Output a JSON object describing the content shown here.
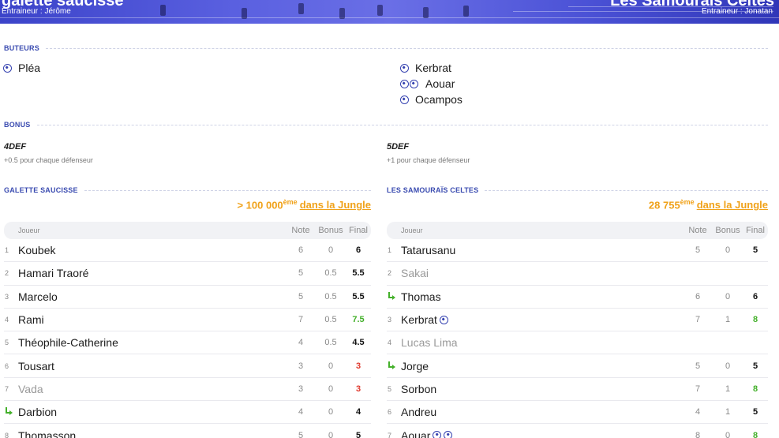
{
  "banner": {
    "left_team": "galette saucisse",
    "left_coach": "Entraineur : Jérôme",
    "right_team": "Les Samouraïs Celtes",
    "right_coach": "Entraineur : Jonatan"
  },
  "sections": {
    "scorers": "BUTEURS",
    "bonus": "BONUS",
    "left_team_header": "GALETTE SAUCISSE",
    "right_team_header": "LES SAMOURAÏS CELTES"
  },
  "scorers": {
    "left": [
      {
        "name": "Pléa",
        "goals": 1
      }
    ],
    "right": [
      {
        "name": "Kerbrat",
        "goals": 1
      },
      {
        "name": "Aouar",
        "goals": 2
      },
      {
        "name": "Ocampos",
        "goals": 1
      }
    ]
  },
  "bonus": {
    "left": {
      "name": "4DEF",
      "desc": "+0.5 pour chaque défenseur"
    },
    "right": {
      "name": "5DEF",
      "desc": "+1 pour chaque défenseur"
    }
  },
  "ranking": {
    "left": {
      "value": "> 100 000",
      "sup": "ème",
      "link": "dans la Jungle"
    },
    "right": {
      "value": "28 755",
      "sup": "ème",
      "link": "dans la Jungle"
    }
  },
  "table_headers": {
    "player": "Joueur",
    "note": "Note",
    "bonus": "Bonus",
    "final": "Final"
  },
  "left_players": [
    {
      "num": "1",
      "name": "Koubek",
      "note": "6",
      "bonus": "0",
      "final": "6",
      "status": "black"
    },
    {
      "num": "2",
      "name": "Hamari Traoré",
      "note": "5",
      "bonus": "0.5",
      "final": "5.5",
      "status": "black"
    },
    {
      "num": "3",
      "name": "Marcelo",
      "note": "5",
      "bonus": "0.5",
      "final": "5.5",
      "status": "black"
    },
    {
      "num": "4",
      "name": "Rami",
      "note": "7",
      "bonus": "0.5",
      "final": "7.5",
      "status": "green"
    },
    {
      "num": "5",
      "name": "Théophile-Catherine",
      "note": "4",
      "bonus": "0.5",
      "final": "4.5",
      "status": "black"
    },
    {
      "num": "6",
      "name": "Tousart",
      "note": "3",
      "bonus": "0",
      "final": "3",
      "status": "red"
    },
    {
      "num": "7",
      "name": "Vada",
      "note": "3",
      "bonus": "0",
      "final": "3",
      "status": "red",
      "dim": true
    },
    {
      "num": "",
      "name": "Darbion",
      "note": "4",
      "bonus": "0",
      "final": "4",
      "status": "black",
      "sub": true
    },
    {
      "num": "8",
      "name": "Thomasson",
      "note": "5",
      "bonus": "0",
      "final": "5",
      "status": "black"
    }
  ],
  "right_players": [
    {
      "num": "1",
      "name": "Tatarusanu",
      "note": "5",
      "bonus": "0",
      "final": "5",
      "status": "black"
    },
    {
      "num": "2",
      "name": "Sakai",
      "note": "",
      "bonus": "",
      "final": "",
      "status": "black",
      "dim": true
    },
    {
      "num": "",
      "name": "Thomas",
      "note": "6",
      "bonus": "0",
      "final": "6",
      "status": "black",
      "sub": true
    },
    {
      "num": "3",
      "name": "Kerbrat",
      "note": "7",
      "bonus": "1",
      "final": "8",
      "status": "green",
      "goals": 1
    },
    {
      "num": "4",
      "name": "Lucas Lima",
      "note": "",
      "bonus": "",
      "final": "",
      "status": "black",
      "dim": true
    },
    {
      "num": "",
      "name": "Jorge",
      "note": "5",
      "bonus": "0",
      "final": "5",
      "status": "black",
      "sub": true
    },
    {
      "num": "5",
      "name": "Sorbon",
      "note": "7",
      "bonus": "1",
      "final": "8",
      "status": "green"
    },
    {
      "num": "6",
      "name": "Andreu",
      "note": "4",
      "bonus": "1",
      "final": "5",
      "status": "black"
    },
    {
      "num": "7",
      "name": "Aouar",
      "note": "8",
      "bonus": "0",
      "final": "8",
      "status": "green",
      "goals": 2
    }
  ]
}
